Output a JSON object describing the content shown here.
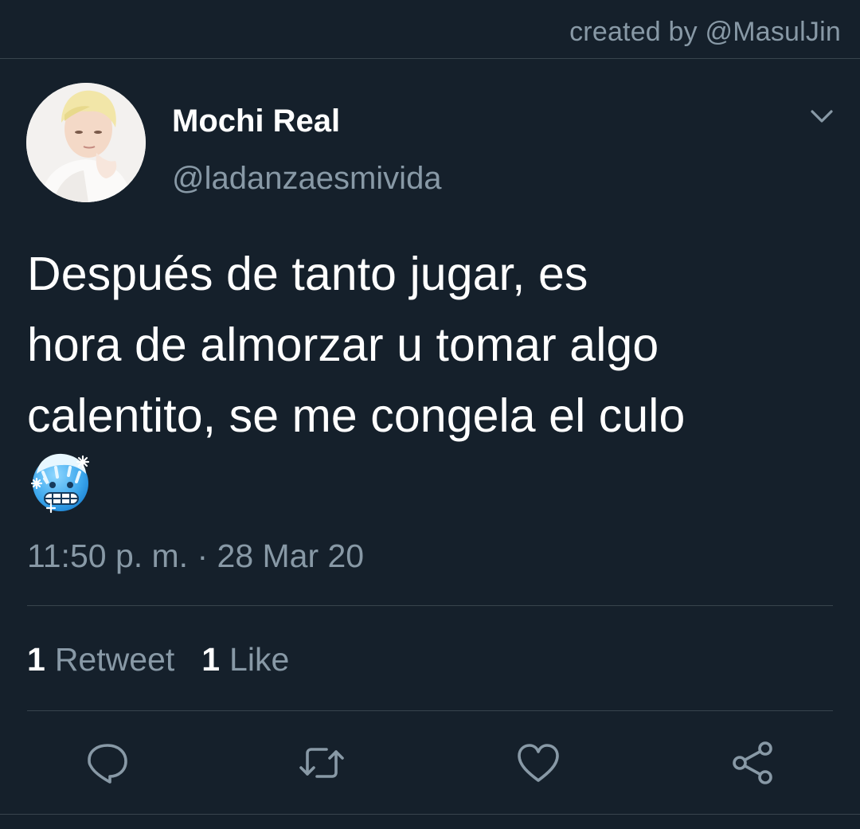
{
  "credit": "created by @MasulJin",
  "author": {
    "display_name": "Mochi Real",
    "handle": "@ladanzaesmivida"
  },
  "tweet": {
    "lines": [
      "Después de tanto jugar, es",
      "hora de almorzar u tomar algo",
      "calentito, se me congela el culo"
    ],
    "emoji": "freezing-face-emoji",
    "timestamp": "11:50 p. m. · 28 Mar 20"
  },
  "stats": {
    "retweets_count": "1",
    "retweets_label": "Retweet",
    "likes_count": "1",
    "likes_label": "Like"
  },
  "actions": [
    "reply-icon",
    "retweet-icon",
    "like-icon",
    "share-icon"
  ],
  "colors": {
    "background": "#15202b",
    "text_primary": "#ffffff",
    "text_secondary": "#8899a6",
    "divider": "#38444d"
  }
}
